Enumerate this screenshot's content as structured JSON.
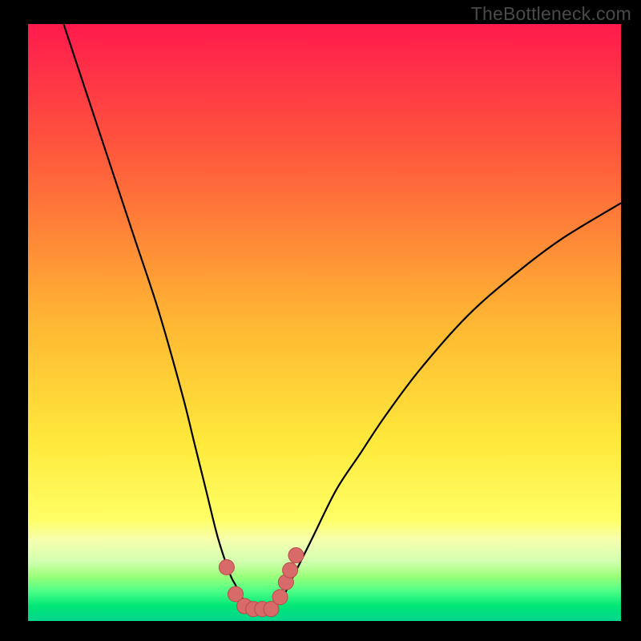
{
  "watermark": "TheBottleneck.com",
  "colors": {
    "black": "#000000",
    "curve": "#000000",
    "marker_fill": "#d96a6a",
    "marker_stroke": "#bb4a4a",
    "grad_top": "#ff1a4d",
    "grad_mid1": "#ff7a33",
    "grad_mid2": "#ffe93b",
    "grad_band_light": "#f6ffb0",
    "grad_green1": "#9cff7a",
    "grad_green2": "#00e676",
    "grad_green3": "#00d68f"
  },
  "chart_data": {
    "type": "line",
    "title": "",
    "xlabel": "",
    "ylabel": "",
    "xlim": [
      0,
      100
    ],
    "ylim": [
      0,
      100
    ],
    "grid": false,
    "series": [
      {
        "name": "bottleneck-curve",
        "x": [
          6,
          10,
          14,
          18,
          22,
          26,
          28,
          30,
          32,
          34,
          35,
          36,
          37,
          38,
          39,
          40,
          41,
          42,
          43,
          44,
          46,
          48,
          52,
          56,
          60,
          66,
          74,
          82,
          90,
          100
        ],
        "y": [
          100,
          88,
          76,
          64,
          52,
          38,
          30,
          22,
          14,
          8,
          6,
          4,
          3,
          2,
          2,
          2,
          2,
          3,
          4,
          6,
          10,
          14,
          22,
          28,
          34,
          42,
          51,
          58,
          64,
          70
        ]
      }
    ],
    "markers": {
      "name": "highlighted-points",
      "x": [
        33.5,
        35.0,
        36.5,
        38.0,
        39.5,
        41.0,
        42.5,
        43.5,
        44.2,
        45.2
      ],
      "y": [
        9.0,
        4.5,
        2.5,
        2.0,
        2.0,
        2.0,
        4.0,
        6.5,
        8.5,
        11.0
      ]
    },
    "gradient_stops": [
      {
        "offset": 0.0,
        "color": "#ff1a4d"
      },
      {
        "offset": 0.22,
        "color": "#ff5a3c"
      },
      {
        "offset": 0.5,
        "color": "#ffb733"
      },
      {
        "offset": 0.7,
        "color": "#ffe93b"
      },
      {
        "offset": 0.83,
        "color": "#ffff66"
      },
      {
        "offset": 0.865,
        "color": "#f6ffb0"
      },
      {
        "offset": 0.9,
        "color": "#d2ffb0"
      },
      {
        "offset": 0.925,
        "color": "#9cff7a"
      },
      {
        "offset": 0.95,
        "color": "#4dff88"
      },
      {
        "offset": 0.975,
        "color": "#00e676"
      },
      {
        "offset": 1.0,
        "color": "#00d68f"
      }
    ]
  }
}
